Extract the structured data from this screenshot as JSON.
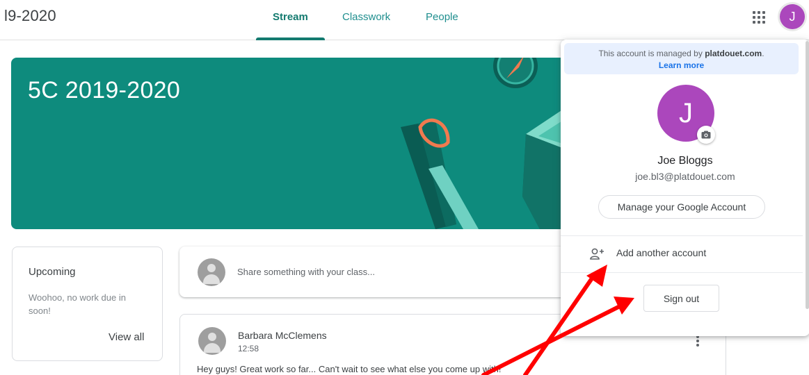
{
  "header": {
    "class_title": "l9-2020",
    "tabs": [
      {
        "label": "Stream",
        "active": true
      },
      {
        "label": "Classwork",
        "active": false
      },
      {
        "label": "People",
        "active": false
      }
    ],
    "apps_icon": "apps-grid-icon",
    "avatar_letter": "J"
  },
  "banner": {
    "title": "5C 2019-2020",
    "color": "#0e8b7d"
  },
  "upcoming": {
    "title": "Upcoming",
    "message": "Woohoo, no work due in soon!",
    "view_all": "View all"
  },
  "share": {
    "placeholder": "Share something with your class..."
  },
  "post": {
    "author": "Barbara McClemens",
    "time": "12:58",
    "text": "Hey guys! Great work so far... Can't wait to see what else you come up with!"
  },
  "account_menu": {
    "managed_prefix": "This account is managed by ",
    "managed_domain": "platdouet.com",
    "managed_suffix": ".",
    "learn_more": "Learn more",
    "avatar_letter": "J",
    "name": "Joe Bloggs",
    "email": "joe.bl3@platdouet.com",
    "manage_button": "Manage your Google Account",
    "add_account": "Add another account",
    "sign_out": "Sign out"
  },
  "colors": {
    "accent": "#137a6f",
    "avatar": "#ab47bc",
    "link": "#1a73e8",
    "annotation": "#ff0000"
  }
}
